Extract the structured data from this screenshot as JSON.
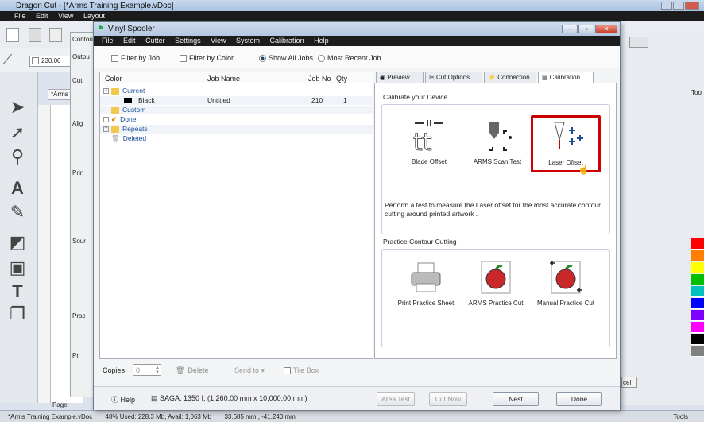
{
  "app": {
    "title": "Dragon Cut - [*Arms Training Example.vDoc]",
    "menu": [
      "File",
      "Edit",
      "View",
      "Layout"
    ],
    "zoom": "230.00",
    "doc_tab": "*Arms",
    "contour_label": "Contour",
    "output_label": "Outpu",
    "cut_label": "Cut",
    "align_label": "Alig",
    "print_label": "Prin",
    "source_label": "Sour",
    "practice_label": "Prac",
    "pr_label": "Pr",
    "page_label": "Page",
    "right_label": "Too",
    "cancel_fragment": "cel"
  },
  "status": {
    "doc": "*Arms Training Example.vDoc",
    "memory": "48%  Used: 228.3 Mb, Avail: 1,063 Mb",
    "coords": "33.685 mm , -41.240 mm",
    "tools": "Tools"
  },
  "spooler": {
    "title": "Vinyl Spooler",
    "menu": [
      "File",
      "Edit",
      "Cutter",
      "Settings",
      "View",
      "System",
      "Calibration",
      "Help"
    ],
    "filters": {
      "by_job": "Filter by Job",
      "by_color": "Filter by Color",
      "show_all": "Show All Jobs",
      "most_recent": "Most Recent Job"
    },
    "columns": [
      "Color",
      "Job Name",
      "Job No",
      "Qty"
    ],
    "tree": {
      "current": "Current",
      "job_color": "Black",
      "job_name": "Untitled",
      "job_no": "210",
      "job_qty": "1",
      "custom": "Custom",
      "done": "Done",
      "repeats": "Repeats",
      "deleted": "Deleted"
    },
    "copies_label": "Copies",
    "copies_value": "0",
    "delete_label": "Delete",
    "send_to_label": "Send to ▾",
    "tile_box_label": "Tile Box",
    "help_label": "Help",
    "device": "SAGA: 1350 I,  (1,260.00 mm x 10,000.00 mm)",
    "area_test": "Area Test",
    "cut_now": "Cut Now",
    "nest": "Nest",
    "done_btn": "Done"
  },
  "tabs": [
    "Preview",
    "Cut Options",
    "Connection",
    "Calibration"
  ],
  "calibration": {
    "group1_title": "Calibrate your Device",
    "blade_offset": "Blade Offset",
    "arms_scan_test": "ARMS Scan Test",
    "laser_offset": "Laser Offset",
    "description": "Perform a test to measure the Laser offset for the most accurate contour cutting around printed artwork .",
    "group2_title": "Practice Contour Cutting",
    "print_practice": "Print Practice Sheet",
    "arms_practice": "ARMS Practice Cut",
    "manual_practice": "Manual Practice Cut"
  },
  "colors": {
    "highlight": "#cc0000",
    "tree_blue": "#1a4fa0",
    "palette": [
      "#ff0000",
      "#ff8000",
      "#ffff00",
      "#00c000",
      "#00c0c0",
      "#0000ff",
      "#8000ff",
      "#ff00ff",
      "#000000",
      "#808080"
    ]
  }
}
